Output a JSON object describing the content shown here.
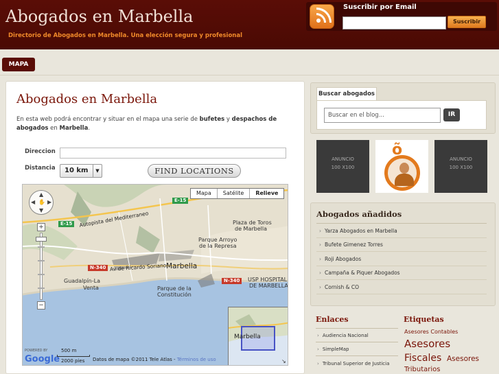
{
  "header": {
    "title": "Abogados en Marbella",
    "tagline": "Directorio de Abogados en Marbella. Una elección segura y profesional",
    "subscribe_label": "Suscribir por Email",
    "subscribe_button": "Suscribir",
    "rss_icon": "rss-icon"
  },
  "nav": {
    "items": [
      {
        "label": "MAPA"
      }
    ]
  },
  "main": {
    "title": "Abogados en Marbella",
    "intro_1": "En esta web podrá encontrar y situar en el mapa una serie de ",
    "intro_b1": "bufetes",
    "intro_2": " y ",
    "intro_b2": "despachos de abogados",
    "intro_3": " en ",
    "intro_b3": "Marbella",
    "intro_4": ".",
    "form": {
      "direccion_label": "Direccion",
      "direccion_value": "",
      "distancia_label": "Distancia",
      "distancia_value": "10 km",
      "find_button": "FIND LOCATIONS"
    },
    "map": {
      "tabs": [
        {
          "label": "Mapa"
        },
        {
          "label": "Satélite"
        },
        {
          "label": "Relieve"
        }
      ],
      "active_tab": "Relieve",
      "labels": {
        "autopista": "Autopista del Mediterraneo",
        "plaza": "Plaza de Toros",
        "plaza2": "de Marbella",
        "parque_arroyo": "Parque Arroyo",
        "parque_arroyo2": "de la Represa",
        "ricardo": "Av de Ricardo Soriano",
        "marbella": "Marbella",
        "guadalpin": "Guadalpín-La",
        "guadalpin2": "Venta",
        "parque_const": "Parque de la",
        "parque_const2": "Constitución",
        "usp": "USP HOSPITAL",
        "usp2": "DE MARBELLA",
        "overview_label": "Marbella"
      },
      "badges": {
        "e15a": "E-15",
        "e15b": "E-15",
        "e15c": "E-15",
        "n340a": "N-340",
        "n340b": "N-340"
      },
      "powered": "POWERED BY",
      "google": "Google",
      "scale_m": "500 m",
      "scale_ft": "2000 pies",
      "credit": "Datos de mapa ©2011 Tele Atlas - ",
      "terms": "Términos de uso",
      "zoom_plus": "+",
      "zoom_minus": "−"
    }
  },
  "sidebar": {
    "search": {
      "tab": "Buscar abogados",
      "placeholder": "Buscar en el blog...",
      "button": "IR"
    },
    "ads": [
      {
        "line1": "ANUNCIO",
        "line2": "100 X100"
      },
      {
        "line1": "ANUNCIO",
        "line2": "100 X100"
      }
    ],
    "added": {
      "title": "Abogados añadidos",
      "items": [
        {
          "label": "Yarza Abogados en Marbella"
        },
        {
          "label": "Bufete Gimenez Torres"
        },
        {
          "label": "Roji Abogados"
        },
        {
          "label": "Campaña & Piquer Abogados"
        },
        {
          "label": "Cornish & CO"
        }
      ]
    },
    "enlaces": {
      "title": "Enlaces",
      "items": [
        {
          "label": "Audiencia Nacional"
        },
        {
          "label": "SimpleMap"
        },
        {
          "label": "Tribunal Superior de Justicia"
        }
      ]
    },
    "etiquetas": {
      "title": "Etiquetas",
      "tags": [
        {
          "label": "Asesores Contables"
        },
        {
          "label": "Asesores"
        },
        {
          "label": "Fiscales"
        },
        {
          "label": "Asesores"
        },
        {
          "label": "Tributarios"
        }
      ]
    }
  },
  "colors": {
    "brand_dark": "#5a0d06",
    "accent_orange": "#f08a2a",
    "title_red": "#7a160a",
    "sidebar_bg": "#e3dfd2"
  }
}
